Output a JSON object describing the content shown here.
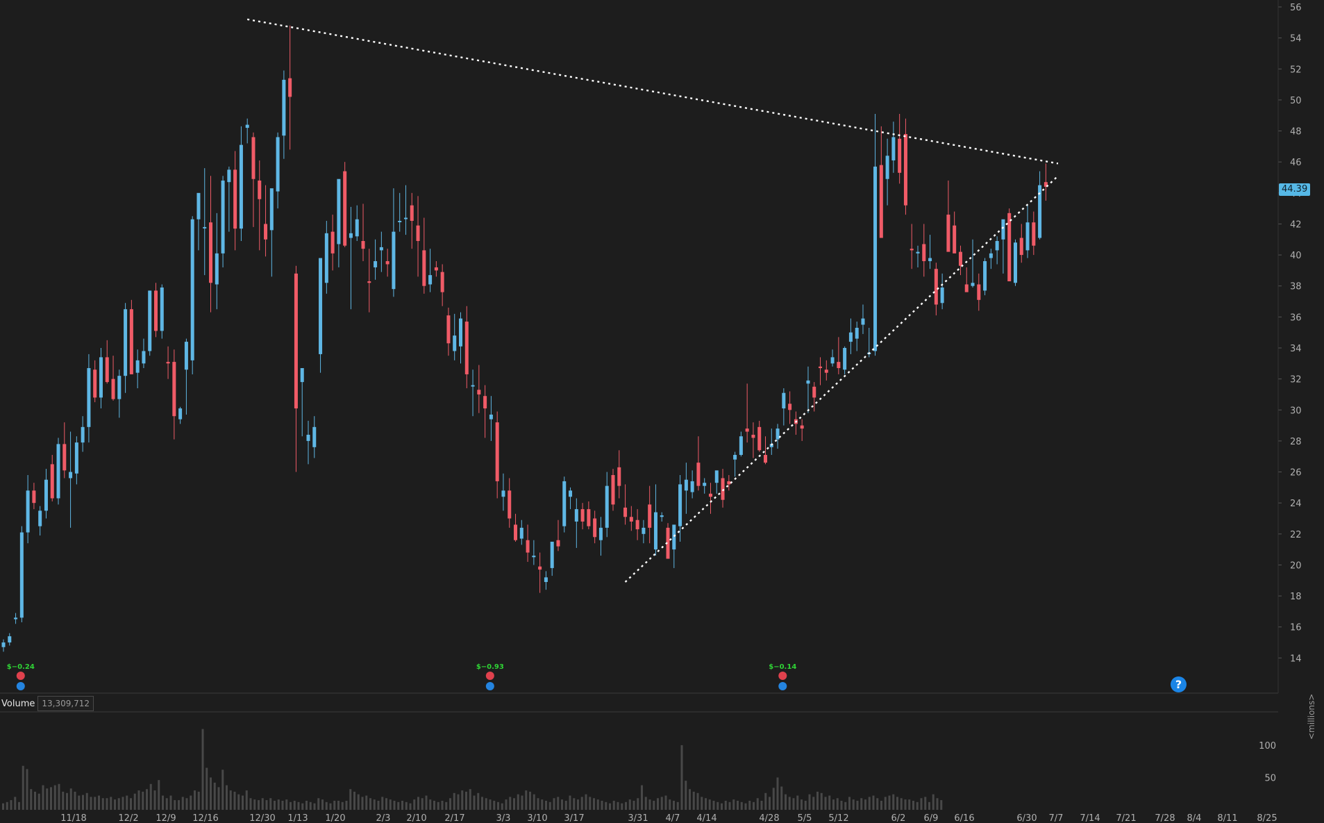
{
  "chart_data": [
    {
      "type": "candlestick",
      "title": "",
      "ylim": [
        12,
        56
      ],
      "y_ticks": [
        14,
        16,
        18,
        20,
        22,
        24,
        26,
        28,
        30,
        32,
        34,
        36,
        38,
        40,
        42,
        44,
        46,
        48,
        50,
        52,
        54,
        56
      ],
      "x_tick_labels": [
        "11/18",
        "12/2",
        "12/9",
        "12/16",
        "12/30",
        "1/13",
        "1/20",
        "2/3",
        "2/10",
        "2/17",
        "3/3",
        "3/10",
        "3/17",
        "3/31",
        "4/7",
        "4/14",
        "4/28",
        "5/5",
        "5/12",
        "6/2",
        "6/9",
        "6/16",
        "6/30",
        "7/7",
        "7/14",
        "7/21",
        "7/28",
        "8/4",
        "8/11",
        "8/25"
      ],
      "last_price": "44.39",
      "grid": false,
      "colors": {
        "up": "#5fb7e5",
        "down": "#f05b67",
        "background": "#1d1d1d",
        "axis_text": "#b0b0b0",
        "trendline": "#ffffff"
      },
      "candles": [
        [
          14.7,
          15.2,
          14.4,
          15.0
        ],
        [
          15.0,
          15.6,
          14.8,
          15.4
        ],
        [
          16.5,
          16.9,
          16.2,
          16.6
        ],
        [
          16.6,
          22.5,
          16.3,
          22.1
        ],
        [
          22.1,
          25.8,
          21.4,
          24.8
        ],
        [
          24.8,
          25.3,
          23.6,
          24.0
        ],
        [
          22.5,
          23.8,
          21.9,
          23.5
        ],
        [
          23.5,
          26.2,
          23.0,
          25.5
        ],
        [
          26.5,
          27.1,
          24.1,
          24.3
        ],
        [
          24.3,
          28.2,
          23.9,
          27.8
        ],
        [
          27.8,
          29.2,
          25.6,
          26.1
        ],
        [
          25.6,
          28.6,
          22.4,
          26.0
        ],
        [
          25.9,
          28.3,
          25.2,
          27.9
        ],
        [
          27.9,
          29.6,
          27.3,
          28.9
        ],
        [
          28.9,
          33.6,
          27.9,
          32.7
        ],
        [
          32.6,
          33.2,
          30.5,
          30.8
        ],
        [
          30.8,
          34.0,
          30.1,
          33.4
        ],
        [
          33.4,
          34.5,
          31.7,
          31.8
        ],
        [
          32.0,
          33.5,
          30.6,
          30.7
        ],
        [
          30.7,
          32.6,
          29.5,
          32.2
        ],
        [
          32.2,
          36.9,
          31.1,
          36.5
        ],
        [
          36.5,
          37.1,
          32.3,
          32.3
        ],
        [
          32.4,
          33.9,
          31.4,
          33.2
        ],
        [
          33.0,
          34.6,
          32.7,
          33.8
        ],
        [
          33.8,
          37.7,
          33.5,
          37.7
        ],
        [
          37.7,
          38.2,
          34.7,
          35.1
        ],
        [
          35.1,
          38.1,
          34.6,
          37.9
        ],
        [
          33.1,
          34.1,
          32.0,
          33.0
        ],
        [
          33.1,
          33.9,
          28.1,
          29.6
        ],
        [
          29.4,
          30.2,
          29.1,
          30.1
        ],
        [
          32.6,
          34.6,
          29.7,
          34.4
        ],
        [
          33.2,
          42.5,
          32.3,
          42.3
        ],
        [
          42.3,
          43.8,
          40.3,
          44.0
        ],
        [
          41.8,
          45.6,
          38.7,
          41.8
        ],
        [
          42.1,
          45.1,
          36.3,
          38.2
        ],
        [
          38.1,
          42.7,
          36.5,
          40.1
        ],
        [
          40.1,
          45.1,
          39.2,
          44.8
        ],
        [
          44.7,
          45.7,
          41.5,
          45.5
        ],
        [
          45.5,
          46.7,
          40.3,
          41.7
        ],
        [
          41.7,
          48.3,
          40.9,
          47.1
        ],
        [
          48.2,
          48.8,
          47.2,
          48.4
        ],
        [
          47.6,
          47.9,
          41.8,
          44.9
        ],
        [
          44.8,
          46.1,
          40.3,
          43.6
        ],
        [
          42.0,
          44.5,
          39.9,
          41.0
        ],
        [
          41.6,
          43.1,
          38.6,
          44.3
        ],
        [
          44.1,
          47.9,
          43.0,
          47.6
        ],
        [
          47.7,
          51.9,
          46.2,
          51.3
        ],
        [
          51.4,
          54.8,
          46.8,
          50.2
        ],
        [
          38.8,
          39.3,
          26.0,
          30.1
        ],
        [
          31.8,
          32.4,
          28.3,
          32.7
        ],
        [
          28.0,
          29.3,
          26.5,
          28.4
        ],
        [
          27.6,
          29.6,
          26.9,
          28.9
        ],
        [
          33.6,
          37.9,
          32.4,
          39.8
        ],
        [
          38.2,
          42.2,
          37.5,
          41.4
        ],
        [
          41.5,
          42.6,
          39.0,
          40.1
        ],
        [
          40.7,
          44.5,
          39.2,
          44.9
        ],
        [
          45.4,
          46.0,
          40.5,
          40.6
        ],
        [
          41.1,
          43.1,
          36.5,
          41.4
        ],
        [
          41.2,
          43.2,
          40.9,
          42.3
        ],
        [
          40.9,
          43.3,
          39.6,
          40.4
        ],
        [
          38.3,
          40.4,
          36.3,
          38.2
        ],
        [
          39.2,
          41.0,
          38.4,
          39.6
        ],
        [
          40.3,
          41.5,
          38.9,
          40.5
        ],
        [
          39.6,
          40.4,
          38.6,
          39.4
        ],
        [
          37.8,
          44.3,
          37.3,
          41.5
        ],
        [
          42.2,
          44.0,
          41.5,
          42.2
        ],
        [
          42.4,
          44.5,
          41.3,
          42.4
        ],
        [
          43.2,
          44.0,
          40.4,
          42.2
        ],
        [
          41.9,
          43.8,
          38.6,
          40.9
        ],
        [
          40.3,
          42.4,
          37.5,
          38.0
        ],
        [
          38.1,
          40.4,
          37.6,
          38.7
        ],
        [
          39.2,
          39.6,
          38.6,
          39.0
        ],
        [
          38.9,
          39.4,
          36.7,
          37.6
        ],
        [
          36.1,
          36.6,
          33.5,
          34.3
        ],
        [
          33.8,
          36.2,
          33.2,
          34.8
        ],
        [
          34.1,
          36.3,
          33.0,
          35.9
        ],
        [
          35.7,
          36.7,
          31.4,
          32.3
        ],
        [
          31.6,
          32.6,
          29.6,
          31.6
        ],
        [
          31.3,
          32.9,
          29.8,
          31.0
        ],
        [
          30.9,
          31.6,
          28.2,
          30.1
        ],
        [
          29.4,
          30.9,
          28.0,
          29.7
        ],
        [
          29.2,
          29.9,
          24.3,
          25.4
        ],
        [
          24.4,
          25.9,
          23.5,
          24.8
        ],
        [
          24.8,
          25.6,
          22.4,
          23.0
        ],
        [
          22.6,
          23.3,
          21.5,
          21.6
        ],
        [
          21.7,
          22.9,
          21.3,
          22.4
        ],
        [
          21.6,
          22.6,
          20.2,
          20.8
        ],
        [
          20.5,
          21.6,
          20.0,
          20.6
        ],
        [
          19.9,
          20.8,
          18.2,
          19.7
        ],
        [
          18.9,
          19.6,
          18.4,
          19.2
        ],
        [
          19.8,
          21.4,
          19.3,
          21.5
        ],
        [
          21.6,
          22.9,
          20.9,
          21.2
        ],
        [
          22.5,
          25.7,
          22.1,
          25.4
        ],
        [
          24.4,
          25.0,
          23.6,
          24.8
        ],
        [
          22.8,
          24.3,
          21.1,
          23.6
        ],
        [
          23.6,
          24.0,
          22.3,
          22.8
        ],
        [
          23.6,
          24.1,
          22.3,
          22.5
        ],
        [
          23.0,
          23.5,
          21.4,
          21.8
        ],
        [
          21.6,
          23.1,
          20.6,
          22.4
        ],
        [
          22.4,
          26.0,
          21.8,
          25.1
        ],
        [
          25.8,
          26.2,
          23.5,
          23.9
        ],
        [
          26.3,
          27.4,
          24.3,
          25.1
        ],
        [
          23.7,
          25.2,
          22.6,
          23.1
        ],
        [
          23.1,
          23.8,
          22.2,
          22.8
        ],
        [
          22.9,
          23.6,
          21.6,
          22.3
        ],
        [
          22.0,
          22.9,
          21.4,
          22.4
        ],
        [
          23.9,
          25.1,
          21.4,
          22.4
        ],
        [
          21.0,
          25.2,
          20.6,
          23.4
        ],
        [
          23.1,
          23.4,
          22.8,
          23.2
        ],
        [
          22.4,
          22.7,
          20.9,
          20.4
        ],
        [
          21.0,
          22.1,
          19.8,
          22.6
        ],
        [
          22.5,
          25.8,
          21.5,
          25.2
        ],
        [
          24.8,
          26.6,
          23.3,
          25.5
        ],
        [
          24.7,
          26.1,
          24.3,
          25.4
        ],
        [
          26.6,
          28.3,
          24.8,
          25.1
        ],
        [
          25.1,
          25.6,
          24.6,
          25.3
        ],
        [
          24.6,
          25.3,
          23.3,
          24.4
        ],
        [
          25.3,
          26.0,
          24.6,
          26.1
        ],
        [
          25.6,
          26.2,
          23.7,
          24.2
        ],
        [
          25.4,
          25.8,
          24.8,
          25.2
        ],
        [
          26.8,
          27.3,
          25.7,
          27.1
        ],
        [
          27.1,
          28.6,
          27.0,
          28.3
        ],
        [
          28.8,
          31.7,
          27.9,
          28.6
        ],
        [
          28.4,
          29.2,
          26.9,
          28.2
        ],
        [
          28.9,
          29.3,
          27.3,
          27.4
        ],
        [
          27.1,
          28.3,
          26.5,
          26.6
        ],
        [
          27.6,
          28.8,
          27.1,
          27.8
        ],
        [
          28.1,
          29.1,
          27.5,
          28.8
        ],
        [
          30.1,
          31.4,
          29.0,
          31.1
        ],
        [
          30.4,
          31.2,
          29.1,
          30.0
        ],
        [
          29.4,
          29.9,
          28.4,
          29.1
        ],
        [
          29.0,
          29.4,
          28.0,
          28.8
        ],
        [
          31.7,
          32.8,
          29.8,
          31.9
        ],
        [
          31.5,
          31.8,
          29.9,
          30.8
        ],
        [
          32.8,
          33.4,
          31.6,
          32.7
        ],
        [
          32.6,
          33.2,
          31.9,
          32.4
        ],
        [
          33.0,
          33.9,
          32.8,
          33.4
        ],
        [
          33.1,
          34.7,
          32.3,
          32.7
        ],
        [
          32.6,
          34.1,
          32.3,
          34.0
        ],
        [
          34.4,
          35.9,
          33.6,
          35.0
        ],
        [
          34.6,
          35.7,
          33.8,
          35.3
        ],
        [
          35.5,
          36.8,
          34.9,
          35.9
        ],
        [
          33.6,
          35.3,
          33.4,
          33.7
        ],
        [
          33.8,
          49.1,
          33.5,
          45.7
        ],
        [
          45.8,
          48.3,
          41.3,
          41.1
        ],
        [
          44.9,
          47.5,
          43.2,
          46.4
        ],
        [
          46.1,
          48.6,
          45.3,
          47.6
        ],
        [
          47.5,
          49.1,
          44.6,
          45.3
        ],
        [
          47.8,
          48.8,
          42.6,
          43.2
        ],
        [
          40.4,
          42.0,
          39.1,
          40.3
        ],
        [
          40.1,
          40.6,
          39.2,
          40.2
        ],
        [
          40.7,
          42.0,
          38.6,
          39.6
        ],
        [
          39.6,
          41.3,
          39.1,
          39.8
        ],
        [
          39.1,
          39.5,
          36.1,
          36.8
        ],
        [
          36.9,
          38.8,
          36.5,
          37.9
        ],
        [
          42.6,
          44.8,
          40.3,
          40.2
        ],
        [
          41.9,
          42.8,
          40.5,
          40.1
        ],
        [
          40.2,
          40.6,
          38.7,
          39.3
        ],
        [
          38.1,
          39.2,
          37.8,
          37.6
        ],
        [
          38.0,
          41.0,
          37.9,
          38.2
        ],
        [
          38.1,
          38.8,
          36.4,
          37.1
        ],
        [
          37.7,
          39.8,
          37.4,
          39.6
        ],
        [
          39.8,
          40.4,
          39.1,
          40.1
        ],
        [
          40.3,
          41.2,
          39.4,
          40.9
        ],
        [
          41.0,
          42.1,
          38.8,
          42.3
        ],
        [
          42.7,
          43.0,
          38.3,
          38.3
        ],
        [
          38.2,
          41.0,
          38.0,
          40.8
        ],
        [
          41.1,
          42.0,
          39.5,
          40.0
        ],
        [
          40.3,
          43.2,
          39.8,
          42.1
        ],
        [
          42.1,
          42.8,
          40.0,
          40.6
        ],
        [
          41.1,
          45.4,
          41.0,
          44.5
        ],
        [
          44.7,
          45.9,
          43.5,
          44.4
        ]
      ],
      "events": [
        {
          "label": "$−0.24",
          "x_index": 1
        },
        {
          "label": "$−0.93",
          "x_index": 78
        },
        {
          "label": "$−0.14",
          "x_index": 126
        }
      ],
      "trendlines": [
        {
          "name": "",
          "from": {
            "index": 40,
            "price": 55.2
          },
          "to": {
            "index": 173,
            "price": 45.9
          }
        },
        {
          "name": "",
          "from": {
            "index": 102,
            "price": 18.9
          },
          "to": {
            "index": 173,
            "price": 45.1
          }
        }
      ]
    },
    {
      "type": "bar",
      "title": "Volume",
      "ylabel": "<millions>",
      "current_value": "13,309,712",
      "ylim": [
        0,
        130
      ],
      "y_ticks": [
        50,
        100
      ],
      "color": "#484848",
      "values": [
        10,
        12,
        15,
        20,
        12,
        68,
        63,
        32,
        28,
        25,
        38,
        33,
        35,
        38,
        40,
        28,
        26,
        33,
        28,
        22,
        23,
        26,
        20,
        20,
        22,
        18,
        18,
        20,
        16,
        18,
        20,
        22,
        18,
        25,
        30,
        28,
        32,
        40,
        30,
        46,
        22,
        18,
        22,
        15,
        15,
        20,
        18,
        22,
        30,
        28,
        125,
        65,
        50,
        42,
        35,
        62,
        38,
        30,
        28,
        24,
        22,
        30,
        18,
        16,
        15,
        18,
        15,
        18,
        14,
        16,
        14,
        16,
        12,
        14,
        12,
        10,
        14,
        12,
        10,
        18,
        16,
        12,
        10,
        14,
        14,
        12,
        14,
        32,
        28,
        24,
        20,
        22,
        18,
        16,
        14,
        20,
        18,
        16,
        14,
        12,
        14,
        12,
        10,
        16,
        20,
        18,
        22,
        16,
        14,
        12,
        14,
        12,
        18,
        26,
        24,
        30,
        28,
        32,
        22,
        26,
        20,
        18,
        16,
        14,
        12,
        10,
        16,
        20,
        18,
        24,
        22,
        30,
        28,
        24,
        18,
        16,
        14,
        12,
        18,
        20,
        16,
        14,
        22,
        18,
        16,
        20,
        24,
        20,
        18,
        16,
        14,
        12,
        10,
        14,
        12,
        10,
        12,
        16,
        14,
        18,
        38,
        20,
        16,
        14,
        18,
        20,
        22,
        16,
        14,
        12,
        100,
        45,
        32,
        28,
        26,
        20,
        18,
        16,
        14,
        12,
        10,
        14,
        12,
        16,
        14,
        12,
        10,
        14,
        12,
        18,
        14,
        26,
        20,
        34,
        50,
        36,
        24,
        20,
        18,
        22,
        16,
        14,
        24,
        20,
        28,
        26,
        20,
        22,
        16,
        18,
        14,
        12,
        20,
        16,
        14,
        18,
        16,
        20,
        22,
        18,
        14,
        20,
        22,
        24,
        20,
        18,
        16,
        16,
        14,
        12,
        18,
        20,
        12,
        24,
        18,
        15
      ]
    }
  ],
  "volume_panel": {
    "label": "Volume",
    "value": "13,309,712",
    "unit": "<millions>"
  },
  "help_button": {
    "label": "?"
  }
}
